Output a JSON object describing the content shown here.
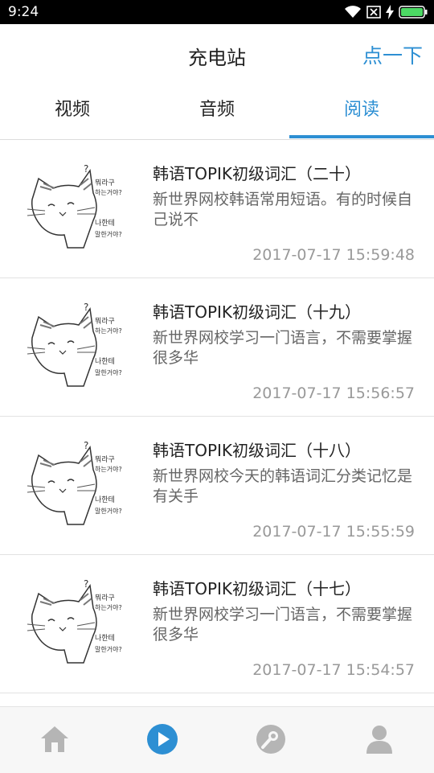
{
  "status_bar": {
    "time": "9:24"
  },
  "header": {
    "title": "充电站",
    "action_label": "点一下"
  },
  "tabs": [
    {
      "label": "视频"
    },
    {
      "label": "音频"
    },
    {
      "label": "阅读"
    }
  ],
  "active_tab": "阅读",
  "articles": [
    {
      "title": "韩语TOPIK初级词汇（二十）",
      "summary": "新世界网校韩语常用短语。有的时候自己说不",
      "time": "2017-07-17 15:59:48"
    },
    {
      "title": "韩语TOPIK初级词汇（十九）",
      "summary": "新世界网校学习一门语言，不需要掌握很多华",
      "time": "2017-07-17 15:56:57"
    },
    {
      "title": "韩语TOPIK初级词汇（十八）",
      "summary": "新世界网校今天的韩语词汇分类记忆是有关手",
      "time": "2017-07-17 15:55:59"
    },
    {
      "title": "韩语TOPIK初级词汇（十七）",
      "summary": "新世界网校学习一门语言，不需要掌握很多华",
      "time": "2017-07-17 15:54:57"
    }
  ],
  "thumbnail_text": {
    "line1": "뭐라구",
    "line2": "하는거야?",
    "line3": "나한테",
    "line4": "말한거야?",
    "mark": "?"
  },
  "bottom_nav": [
    {
      "icon": "home-icon"
    },
    {
      "icon": "play-circle-icon"
    },
    {
      "icon": "wrench-icon"
    },
    {
      "icon": "person-icon"
    }
  ],
  "colors": {
    "accent": "#2d8fd3",
    "nav_inactive": "#b5b5b5"
  }
}
